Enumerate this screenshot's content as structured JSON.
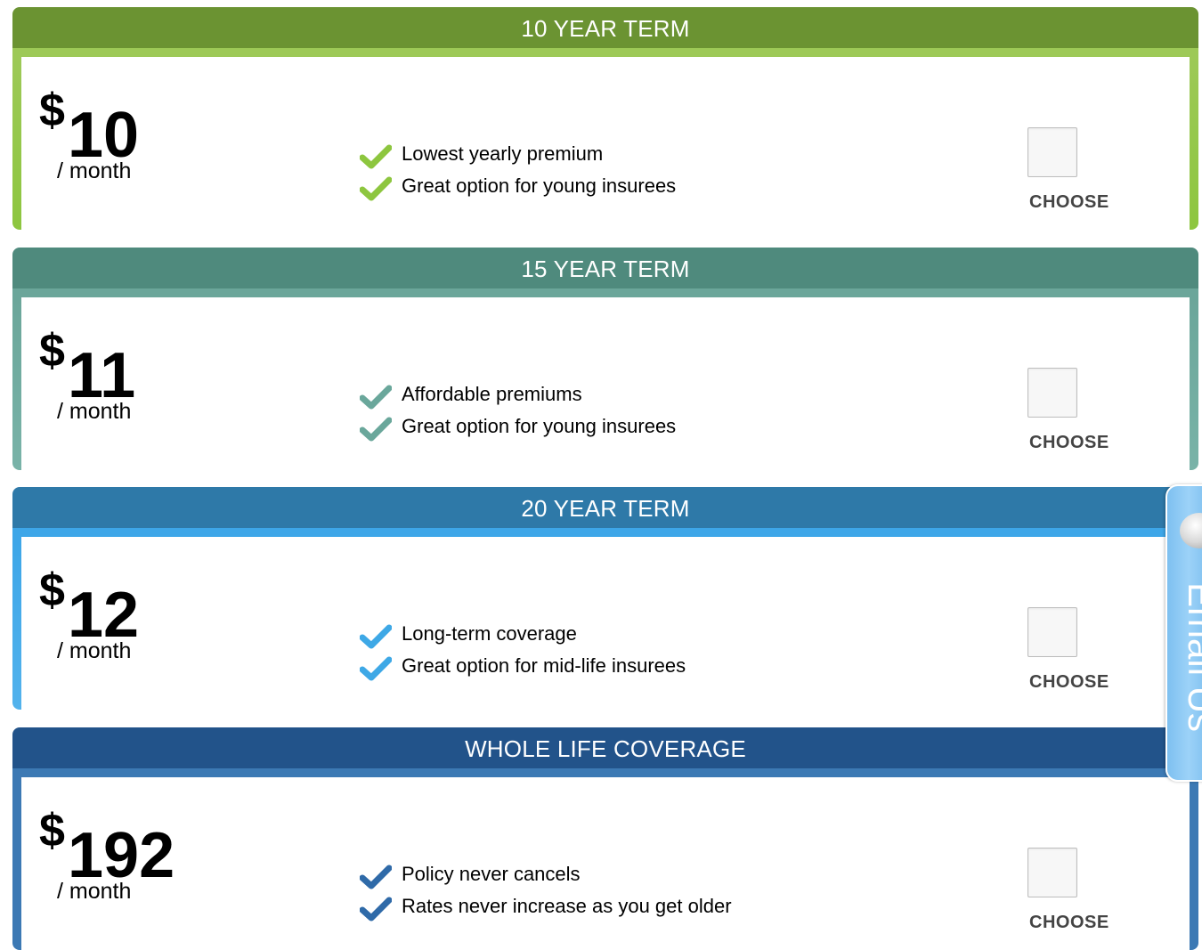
{
  "plans": [
    {
      "title": "10 YEAR TERM",
      "currency": "$",
      "price": "10",
      "period": "/ month",
      "features": [
        "Lowest yearly premium",
        "Great option for young insurees"
      ],
      "choose_label": "CHOOSE",
      "header_color": "#6b9332",
      "accent_color": "#9dc957",
      "edge_top_color": "#9dc957",
      "edge_bottom_color": "#8dc63f",
      "check_color": "#8dc63f",
      "selected": false
    },
    {
      "title": "15 YEAR TERM",
      "currency": "$",
      "price": "11",
      "period": "/ month",
      "features": [
        "Affordable premiums",
        "Great option for young insurees"
      ],
      "choose_label": "CHOOSE",
      "header_color": "#4f8a7d",
      "accent_color": "#6ba69a",
      "edge_top_color": "#6ba69a",
      "edge_bottom_color": "#79b3a8",
      "check_color": "#6aa79b",
      "selected": false
    },
    {
      "title": "20 YEAR TERM",
      "currency": "$",
      "price": "12",
      "period": "/ month",
      "features": [
        "Long-term coverage",
        "Great option for mid-life insurees"
      ],
      "choose_label": "CHOOSE",
      "header_color": "#2e79a8",
      "accent_color": "#3da6e8",
      "edge_top_color": "#3da6e8",
      "edge_bottom_color": "#52b2ec",
      "check_color": "#3ea8e6",
      "selected": false
    },
    {
      "title": "WHOLE LIFE COVERAGE",
      "currency": "$",
      "price": "192",
      "period": "/ month",
      "features": [
        "Policy never cancels",
        "Rates never increase as you get older"
      ],
      "choose_label": "CHOOSE",
      "header_color": "#22538a",
      "accent_color": "#3c79b4",
      "edge_top_color": "#3c79b4",
      "edge_bottom_color": "#3c79b4",
      "check_color": "#2f6aa8",
      "selected": false
    }
  ],
  "email_tab": {
    "label": "Email Us",
    "icon": "chat-bubble-icon",
    "color": "#7ec0f0"
  }
}
